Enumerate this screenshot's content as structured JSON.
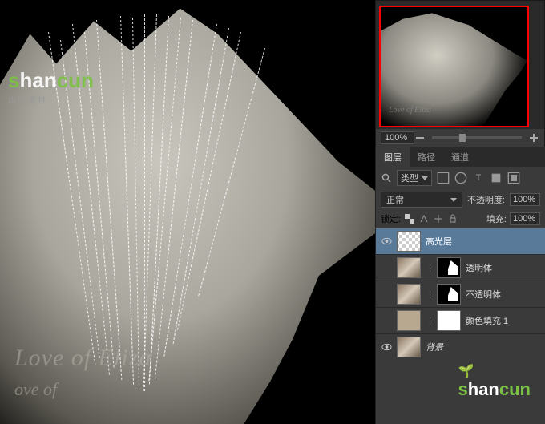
{
  "canvas": {
    "love_text": "Love of Eliza",
    "love_text2": "ove of"
  },
  "watermark": {
    "s": "s",
    "han": "han",
    "cun": "cun",
    "sub": "山村 素材"
  },
  "navigator": {
    "thumb_text": "Love of Eliza",
    "zoom": "100%"
  },
  "panel": {
    "tabs": {
      "layers": "图层",
      "paths": "路径",
      "channels": "通道"
    },
    "filter": {
      "kind": "类型"
    },
    "blend": {
      "mode": "正常",
      "opacity_label": "不透明度:",
      "opacity": "100%"
    },
    "lock": {
      "label": "锁定:",
      "fill_label": "填充:",
      "fill": "100%"
    },
    "layers": [
      {
        "name": "高光层"
      },
      {
        "name": "透明体"
      },
      {
        "name": "不透明体"
      },
      {
        "name": "颜色填充 1"
      },
      {
        "name": "背景"
      }
    ]
  }
}
